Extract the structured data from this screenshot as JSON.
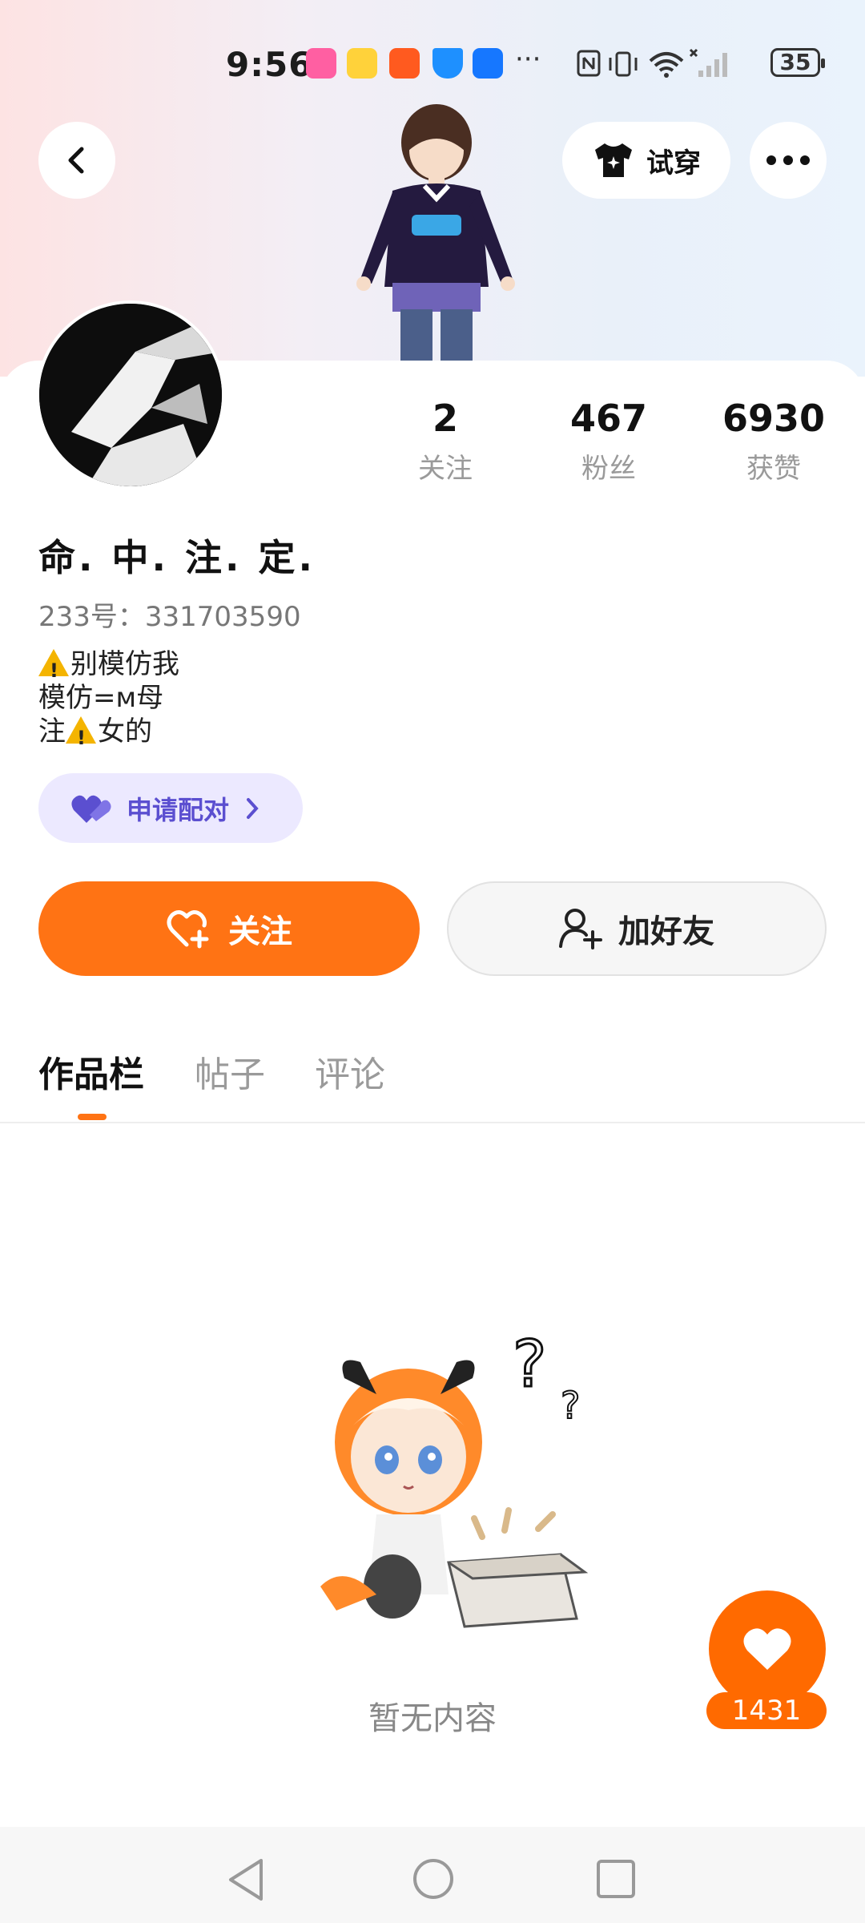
{
  "status_bar": {
    "time": "9:56",
    "more": "···",
    "battery": "35"
  },
  "header": {
    "back_icon": "chevron-left-icon",
    "try_on_label": "试穿",
    "more_icon": "more-dots-icon"
  },
  "profile": {
    "nickname": "命. 中. 注. 定.",
    "uid": "233号：331703590",
    "bio": [
      {
        "warn": true,
        "text": "别模仿我"
      },
      {
        "warn": false,
        "text": "模仿=м母"
      },
      {
        "prefix": "注",
        "warn": true,
        "text": "女的"
      }
    ],
    "stats": [
      {
        "value": "2",
        "label": "关注"
      },
      {
        "value": "467",
        "label": "粉丝"
      },
      {
        "value": "6930",
        "label": "获赞"
      }
    ],
    "pair_label": "申请配对"
  },
  "actions": {
    "follow_label": "关注",
    "add_friend_label": "加好友"
  },
  "tabs": [
    {
      "label": "作品栏",
      "active": true
    },
    {
      "label": "帖子",
      "active": false
    },
    {
      "label": "评论",
      "active": false
    }
  ],
  "empty_state": {
    "text": "暂无内容"
  },
  "like": {
    "count": "1431"
  },
  "colors": {
    "accent": "#ff7314",
    "pair_bg": "#ece9ff",
    "pair_text": "#5b4fd0"
  }
}
